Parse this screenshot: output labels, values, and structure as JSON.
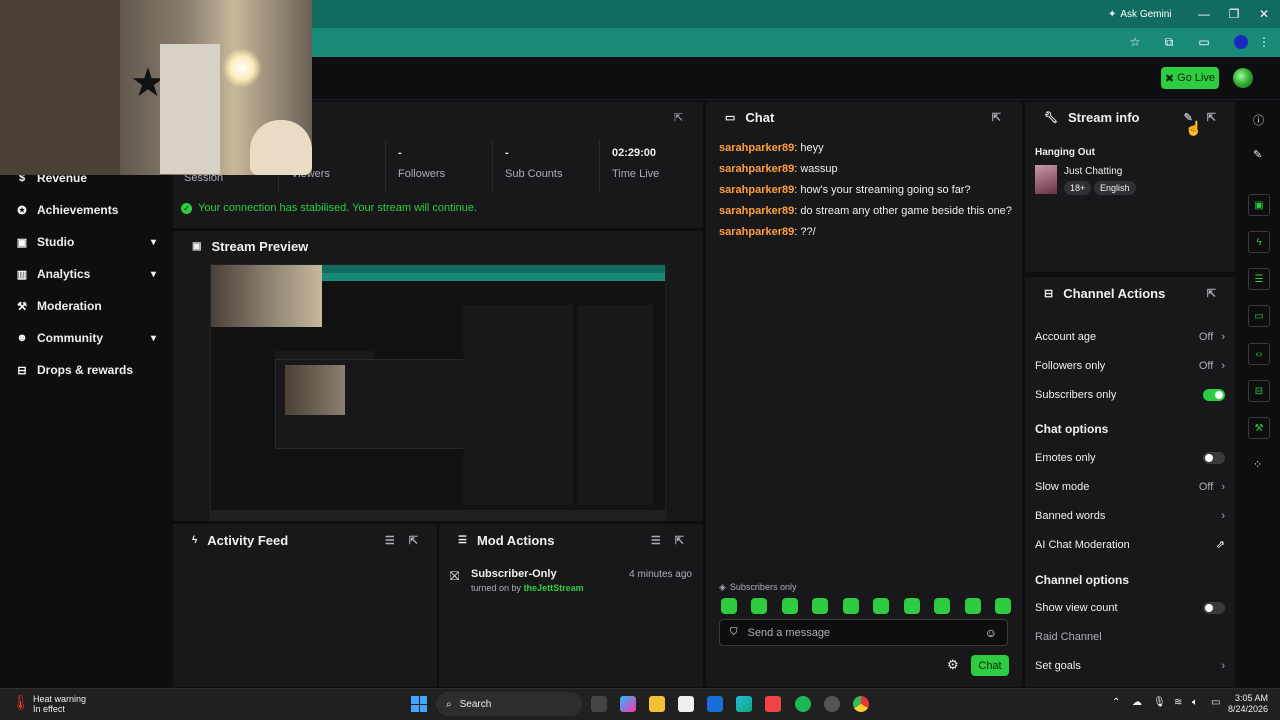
{
  "browser": {
    "ask_gemini": "Ask Gemini"
  },
  "topbar": {
    "go_live": "Go Live"
  },
  "sidebar": {
    "items": [
      {
        "label": "Revenue",
        "icon": "revenue-icon"
      },
      {
        "label": "Achievements",
        "icon": "achievements-icon"
      },
      {
        "label": "Studio",
        "icon": "studio-icon"
      },
      {
        "label": "Analytics",
        "icon": "analytics-icon"
      },
      {
        "label": "Moderation",
        "icon": "moderation-icon"
      },
      {
        "label": "Community",
        "icon": "community-icon"
      },
      {
        "label": "Drops & rewards",
        "icon": "drops-icon"
      }
    ]
  },
  "stats": {
    "session_label": "Session",
    "viewers_label": "Viewers",
    "followers_value": "-",
    "followers_label": "Followers",
    "subs_value": "-",
    "subs_label": "Sub Counts",
    "time_value": "02:29:00",
    "time_label": "Time Live"
  },
  "connection_notice": "Your connection has stabilised. Your stream will continue.",
  "stream_preview": {
    "title": "Stream Preview"
  },
  "activity_feed": {
    "title": "Activity Feed"
  },
  "mod_actions": {
    "title": "Mod Actions",
    "entries": [
      {
        "action": "Subscriber-Only",
        "time": "4 minutes ago",
        "prefix": "turned on by",
        "user": "theJettStream"
      }
    ]
  },
  "chat": {
    "title": "Chat",
    "messages": [
      {
        "user": "sarahparker89",
        "text": ": heyy"
      },
      {
        "user": "sarahparker89",
        "text": ": wassup"
      },
      {
        "user": "sarahparker89",
        "text": ": how's your streaming going so far?"
      },
      {
        "user": "sarahparker89",
        "text": ": do stream any other game beside this one?"
      },
      {
        "user": "sarahparker89",
        "text": ": ??/"
      }
    ],
    "mode_notice": "Subscribers only",
    "input_placeholder": "Send a message",
    "send_label": "Chat"
  },
  "stream_info": {
    "title": "Stream info",
    "stream_title": "Hanging Out",
    "category": "Just Chatting",
    "tags": [
      "18+",
      "English"
    ]
  },
  "channel_actions": {
    "title": "Channel Actions",
    "rows": [
      {
        "label": "Account age",
        "value": "Off"
      },
      {
        "label": "Followers only",
        "value": "Off"
      },
      {
        "label": "Subscribers only",
        "value": ""
      }
    ],
    "chat_options_title": "Chat options",
    "chat_rows": [
      {
        "label": "Emotes only",
        "value": ""
      },
      {
        "label": "Slow mode",
        "value": "Off"
      },
      {
        "label": "Banned words",
        "value": ""
      },
      {
        "label": "AI Chat Moderation",
        "value": ""
      }
    ],
    "channel_options_title": "Channel options",
    "channel_rows": [
      {
        "label": "Show view count",
        "value": ""
      },
      {
        "label": "Raid Channel",
        "value": ""
      },
      {
        "label": "Set goals",
        "value": ""
      }
    ]
  },
  "taskbar": {
    "heat_title": "Heat warning",
    "heat_sub": "In effect",
    "search": "Search",
    "time": "3:05 AM",
    "date": "8/24/2026"
  },
  "colors": {
    "accent": "#2ecc40",
    "username": "#ff9f3a",
    "panel": "#18181b",
    "background": "#0e0e10",
    "chrome": "#116c5f"
  }
}
